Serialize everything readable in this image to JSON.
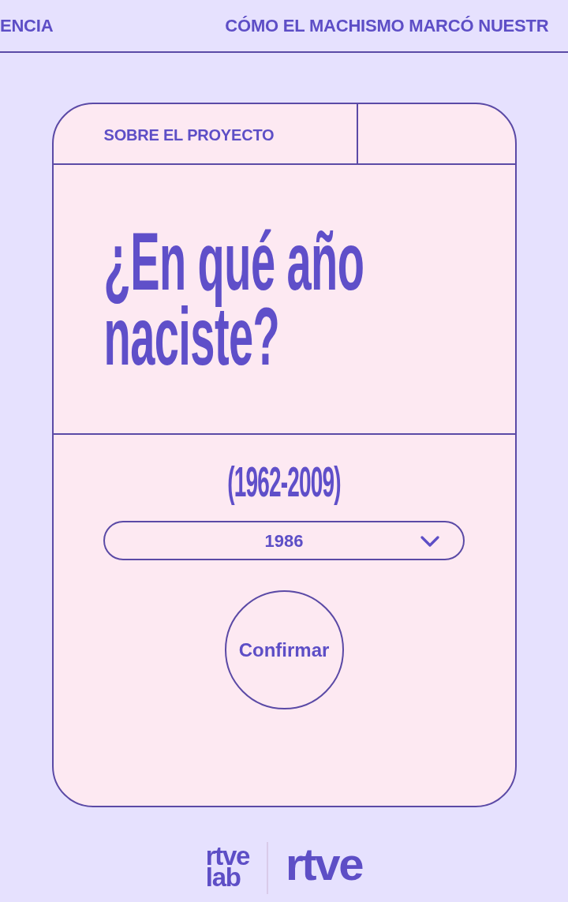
{
  "nav": {
    "links": [
      {
        "label": "ENCIA"
      },
      {
        "label": "CÓMO EL MACHISMO MARCÓ NUESTR"
      }
    ]
  },
  "card": {
    "header": {
      "link": "SOBRE EL PROYECTO"
    },
    "question": "¿En qué año naciste?",
    "range_label": "(1962-2009)",
    "year_select": {
      "value": "1986"
    },
    "confirm_button": "Confirmar"
  },
  "footer": {
    "logos": [
      {
        "lines": [
          "rtve",
          "lab"
        ]
      },
      {
        "lines": [
          "rtve"
        ]
      }
    ]
  }
}
